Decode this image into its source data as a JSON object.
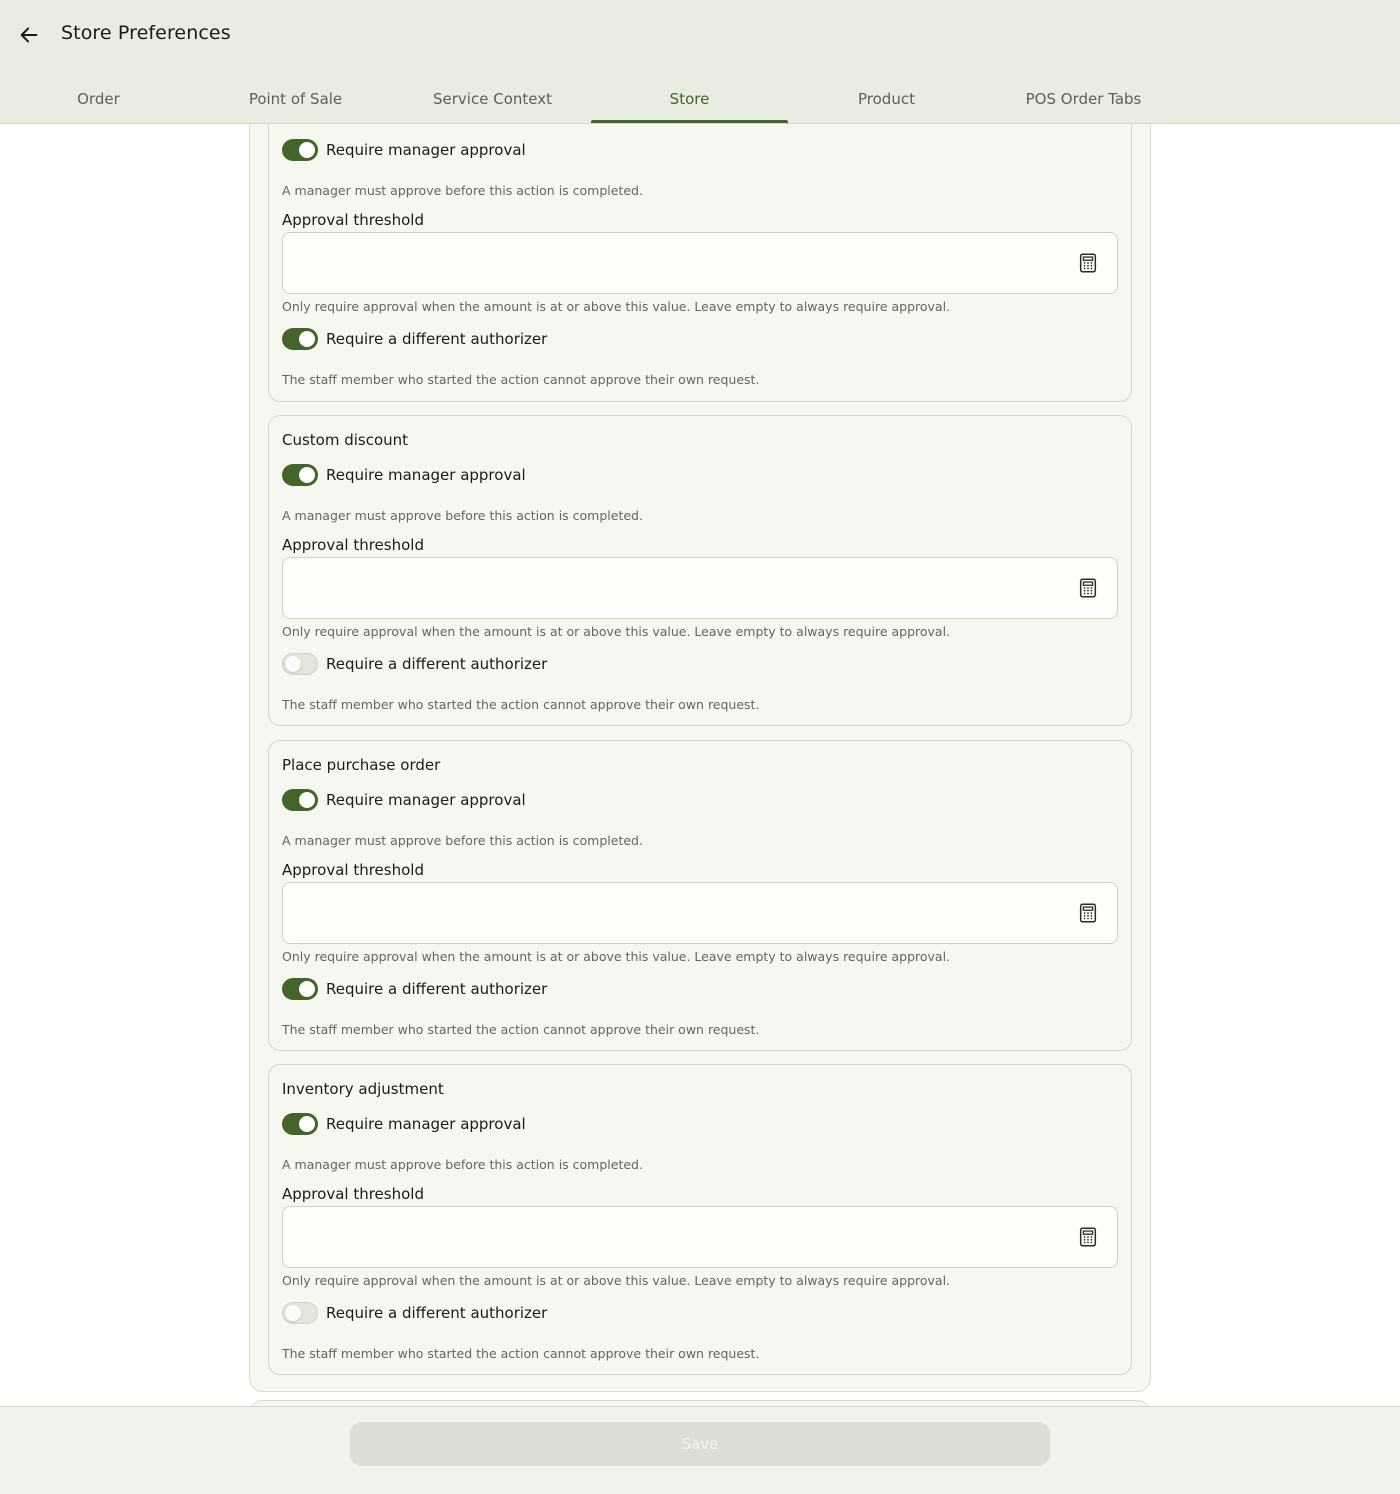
{
  "header": {
    "title": "Store Preferences",
    "back_icon": "arrow-left-icon"
  },
  "tabs": [
    {
      "label": "Order",
      "active": false
    },
    {
      "label": "Point of Sale",
      "active": false
    },
    {
      "label": "Service Context",
      "active": false
    },
    {
      "label": "Store",
      "active": true
    },
    {
      "label": "Product",
      "active": false
    },
    {
      "label": "POS Order Tabs",
      "active": false
    }
  ],
  "colors": {
    "accent": "#44652a",
    "header_bg": "#e9ece0",
    "card_bg": "#f6f7f0"
  },
  "sections": [
    {
      "title": "",
      "manager_approval_label": "Require manager approval",
      "manager_approval_on": true,
      "manager_approval_help": "A manager must approve before this action is completed.",
      "threshold_label": "Approval threshold",
      "threshold_value": "",
      "threshold_help": "Only require approval when the amount is at or above this value. Leave empty to always require approval.",
      "different_authorizer_label": "Require a different authorizer",
      "different_authorizer_on": true,
      "different_authorizer_help": "The staff member who started the action cannot approve their own request."
    },
    {
      "title": "Custom discount",
      "manager_approval_label": "Require manager approval",
      "manager_approval_on": true,
      "manager_approval_help": "A manager must approve before this action is completed.",
      "threshold_label": "Approval threshold",
      "threshold_value": "",
      "threshold_help": "Only require approval when the amount is at or above this value. Leave empty to always require approval.",
      "different_authorizer_label": "Require a different authorizer",
      "different_authorizer_on": false,
      "different_authorizer_help": "The staff member who started the action cannot approve their own request."
    },
    {
      "title": "Place purchase order",
      "manager_approval_label": "Require manager approval",
      "manager_approval_on": true,
      "manager_approval_help": "A manager must approve before this action is completed.",
      "threshold_label": "Approval threshold",
      "threshold_value": "",
      "threshold_help": "Only require approval when the amount is at or above this value. Leave empty to always require approval.",
      "different_authorizer_label": "Require a different authorizer",
      "different_authorizer_on": true,
      "different_authorizer_help": "The staff member who started the action cannot approve their own request."
    },
    {
      "title": "Inventory adjustment",
      "manager_approval_label": "Require manager approval",
      "manager_approval_on": true,
      "manager_approval_help": "A manager must approve before this action is completed.",
      "threshold_label": "Approval threshold",
      "threshold_value": "",
      "threshold_help": "Only require approval when the amount is at or above this value. Leave empty to always require approval.",
      "different_authorizer_label": "Require a different authorizer",
      "different_authorizer_on": false,
      "different_authorizer_help": "The staff member who started the action cannot approve their own request."
    }
  ],
  "footer": {
    "save_label": "Save",
    "save_enabled": false
  }
}
